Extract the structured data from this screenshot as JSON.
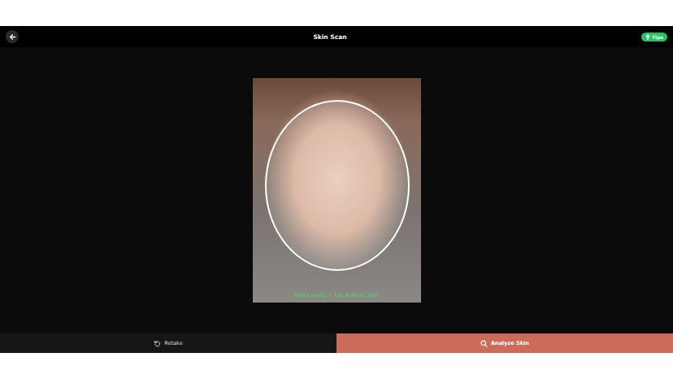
{
  "header": {
    "title": "Skin Scan",
    "tips_label": "Tips"
  },
  "photo": {
    "status": "Photo ready — tap Analyze Skin"
  },
  "actions": [
    {
      "label": "Retake",
      "kind": "secondary"
    },
    {
      "label": "Analyze Skin",
      "kind": "primary"
    }
  ]
}
